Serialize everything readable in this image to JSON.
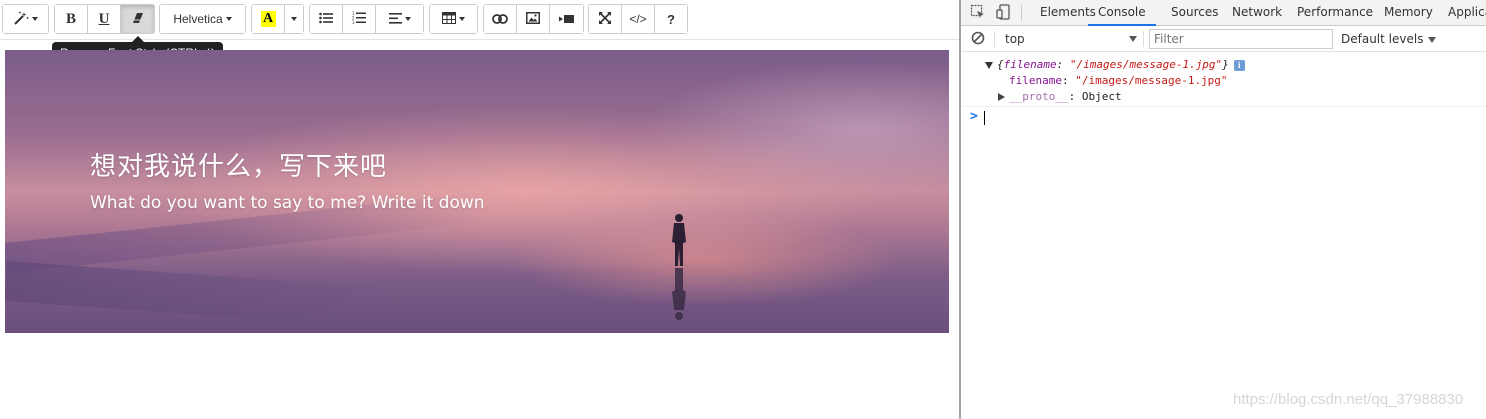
{
  "toolbar": {
    "style_icon": "magic-wand-icon",
    "bold_label": "B",
    "underline_label": "U",
    "clear_format_icon": "eraser-icon",
    "font_family": "Helvetica",
    "highlight_letter": "A",
    "highlight_color": "#ffff00",
    "list_ul_icon": "unordered-list-icon",
    "list_ol_icon": "ordered-list-icon",
    "paragraph_icon": "align-left-icon",
    "table_icon": "table-icon",
    "link_icon": "link-icon",
    "picture_icon": "picture-icon",
    "video_icon": "video-icon",
    "fullscreen_icon": "fullscreen-icon",
    "codeview_label": "</>",
    "help_label": "?"
  },
  "tooltip": {
    "text": "Remove Font Style (CTRL+\\)"
  },
  "banner": {
    "title": "想对我说什么，写下来吧",
    "subtitle": "What do you want to say to me? Write it down"
  },
  "devtools": {
    "tabs": [
      "Elements",
      "Console",
      "Sources",
      "Network",
      "Performance",
      "Memory",
      "Applica"
    ],
    "active_tab": "Console",
    "accent_color": "#1a73e8",
    "context": "top",
    "filter_placeholder": "Filter",
    "levels_label": "Default levels",
    "console": {
      "preview_open": "{",
      "preview_key": "filename",
      "preview_sep": ": ",
      "preview_value": "\"/images/message-1.jpg\"",
      "preview_close": "}",
      "info_badge": "i",
      "prop_key": "filename",
      "prop_sep": ": ",
      "prop_value": "\"/images/message-1.jpg\"",
      "proto_key": "__proto__",
      "proto_sep": ": ",
      "proto_value": "Object",
      "prompt": ">"
    }
  },
  "watermark": "https://blog.csdn.net/qq_37988830"
}
